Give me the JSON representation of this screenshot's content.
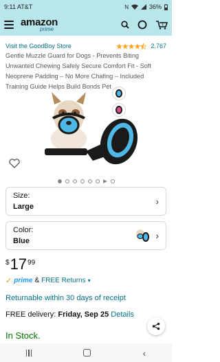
{
  "status": {
    "time": "9:11",
    "carrier": "AT&T",
    "battery": "36%"
  },
  "header": {
    "logo_text": "amazon",
    "logo_sub": "prime"
  },
  "product": {
    "store_link": "Visit the GoodBoy Store",
    "rating_stars": 4.5,
    "rating_count": "2,767",
    "title": "Gentle Muzzle Guard for Dogs - Prevents Biting Unwanted Chewing Safely Secure Comfort Fit - Soft Neoprene Padding – No More Chafing – Included Training Guide Helps Build Bonds Pet",
    "image_alt_colors": [
      "#1a1a1a",
      "#4fb8e6"
    ],
    "thumb_colors": [
      "#4fb8e6",
      "#e04d8c"
    ]
  },
  "size": {
    "label": "Size:",
    "value": "Large"
  },
  "color": {
    "label": "Color:",
    "value": "Blue"
  },
  "price": {
    "currency": "$",
    "whole": "17",
    "cents": "99"
  },
  "shipping": {
    "prime": "prime",
    "amp": "&",
    "free_returns": "FREE Returns",
    "returnable": "Returnable within 30 days of receipt",
    "delivery_prefix": "FREE delivery: ",
    "delivery_date": "Friday, Sep 25",
    "details_link": "Details"
  },
  "stock": "In Stock.",
  "colors": {
    "header_bg": "#b8e6ea",
    "link": "#007185",
    "instock": "#007600",
    "star": "#ffa41c"
  }
}
